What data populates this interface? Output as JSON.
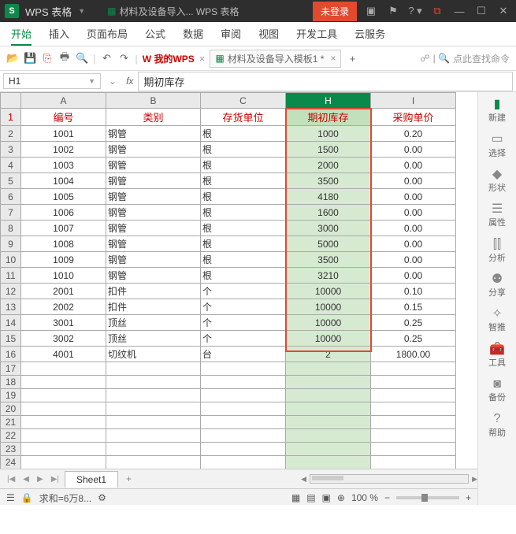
{
  "title": {
    "app": "WPS 表格",
    "doc": "材料及设备导入... WPS 表格",
    "login": "未登录"
  },
  "menu": {
    "items": [
      "开始",
      "插入",
      "页面布局",
      "公式",
      "数据",
      "审阅",
      "视图",
      "开发工具",
      "云服务"
    ],
    "active": 0
  },
  "toolbar": {
    "mywps": "我的WPS",
    "doc_tab": "材料及设备导入模板1 *",
    "search": "点此查找命令"
  },
  "fx": {
    "cell": "H1",
    "value": "期初库存"
  },
  "cols": [
    "A",
    "B",
    "C",
    "H",
    "I"
  ],
  "headers": {
    "a": "编号",
    "b": "类别",
    "c": "存货单位",
    "h": "期初库存",
    "i": "采购单价"
  },
  "rows": [
    {
      "a": "1001",
      "b": "钢管",
      "c": "根",
      "h": "1000",
      "i": "0.20"
    },
    {
      "a": "1002",
      "b": "钢管",
      "c": "根",
      "h": "1500",
      "i": "0.00"
    },
    {
      "a": "1003",
      "b": "钢管",
      "c": "根",
      "h": "2000",
      "i": "0.00"
    },
    {
      "a": "1004",
      "b": "钢管",
      "c": "根",
      "h": "3500",
      "i": "0.00"
    },
    {
      "a": "1005",
      "b": "钢管",
      "c": "根",
      "h": "4180",
      "i": "0.00"
    },
    {
      "a": "1006",
      "b": "钢管",
      "c": "根",
      "h": "1600",
      "i": "0.00"
    },
    {
      "a": "1007",
      "b": "钢管",
      "c": "根",
      "h": "3000",
      "i": "0.00"
    },
    {
      "a": "1008",
      "b": "钢管",
      "c": "根",
      "h": "5000",
      "i": "0.00"
    },
    {
      "a": "1009",
      "b": "钢管",
      "c": "根",
      "h": "3500",
      "i": "0.00"
    },
    {
      "a": "1010",
      "b": "钢管",
      "c": "根",
      "h": "3210",
      "i": "0.00"
    },
    {
      "a": "2001",
      "b": "扣件",
      "c": "个",
      "h": "10000",
      "i": "0.10"
    },
    {
      "a": "2002",
      "b": "扣件",
      "c": "个",
      "h": "10000",
      "i": "0.15"
    },
    {
      "a": "3001",
      "b": "顶丝",
      "c": "个",
      "h": "10000",
      "i": "0.25"
    },
    {
      "a": "3002",
      "b": "顶丝",
      "c": "个",
      "h": "10000",
      "i": "0.25"
    },
    {
      "a": "4001",
      "b": "切纹机",
      "c": "台",
      "h": "2",
      "i": "1800.00"
    }
  ],
  "empty_rows": 11,
  "chart_data": {
    "type": "table",
    "columns": [
      "编号",
      "类别",
      "存货单位",
      "期初库存",
      "采购单价"
    ],
    "data": [
      [
        "1001",
        "钢管",
        "根",
        1000,
        0.2
      ],
      [
        "1002",
        "钢管",
        "根",
        1500,
        0.0
      ],
      [
        "1003",
        "钢管",
        "根",
        2000,
        0.0
      ],
      [
        "1004",
        "钢管",
        "根",
        3500,
        0.0
      ],
      [
        "1005",
        "钢管",
        "根",
        4180,
        0.0
      ],
      [
        "1006",
        "钢管",
        "根",
        1600,
        0.0
      ],
      [
        "1007",
        "钢管",
        "根",
        3000,
        0.0
      ],
      [
        "1008",
        "钢管",
        "根",
        5000,
        0.0
      ],
      [
        "1009",
        "钢管",
        "根",
        3500,
        0.0
      ],
      [
        "1010",
        "钢管",
        "根",
        3210,
        0.0
      ],
      [
        "2001",
        "扣件",
        "个",
        10000,
        0.1
      ],
      [
        "2002",
        "扣件",
        "个",
        10000,
        0.15
      ],
      [
        "3001",
        "顶丝",
        "个",
        10000,
        0.25
      ],
      [
        "3002",
        "顶丝",
        "个",
        10000,
        0.25
      ],
      [
        "4001",
        "切纹机",
        "台",
        2,
        1800.0
      ]
    ]
  },
  "sheet": {
    "name": "Sheet1"
  },
  "status": {
    "sum": "求和=6万8...",
    "zoom": "100 %"
  },
  "side": {
    "new": "新建",
    "select": "选择",
    "shape": "形状",
    "prop": "属性",
    "analyze": "分析",
    "share": "分享",
    "smart": "智推",
    "tool": "工具",
    "backup": "备份",
    "help": "帮助"
  }
}
